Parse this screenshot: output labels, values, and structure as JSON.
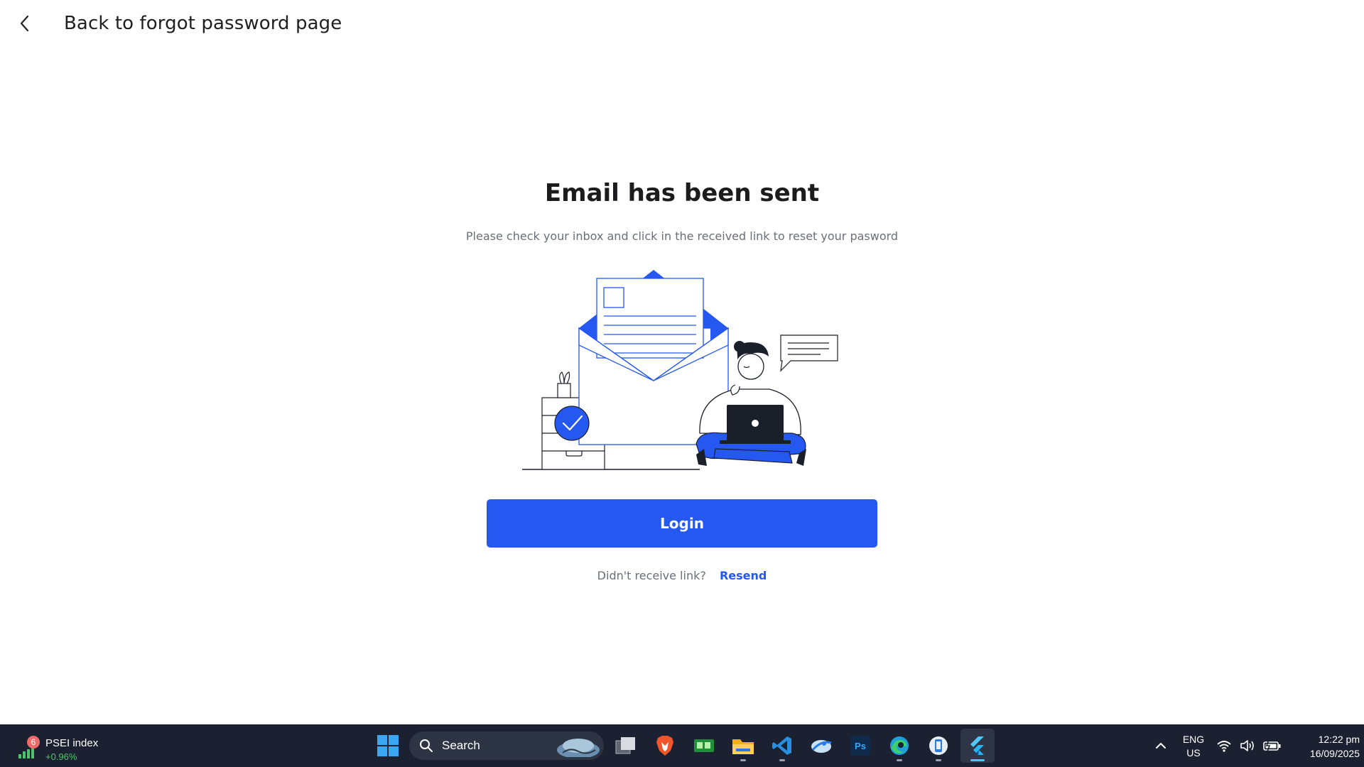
{
  "header": {
    "back_label": "Back to forgot password page"
  },
  "main": {
    "title": "Email has been sent",
    "subtitle": "Please check your inbox and click in the received link to reset your pasword",
    "login_label": "Login",
    "resend_question": "Didn't receive link?",
    "resend_label": "Resend",
    "accent_color": "#2458f0"
  },
  "taskbar": {
    "widget": {
      "badge": "6",
      "title": "PSEI index",
      "change": "+0.96%"
    },
    "search_placeholder": "Search",
    "apps": [
      {
        "name": "task-view-icon"
      },
      {
        "name": "brave-browser-icon"
      },
      {
        "name": "system-monitor-icon"
      },
      {
        "name": "file-explorer-icon"
      },
      {
        "name": "vscode-icon"
      },
      {
        "name": "dbeaver-icon"
      },
      {
        "name": "photoshop-icon",
        "label": "Ps"
      },
      {
        "name": "edge-browser-icon"
      },
      {
        "name": "phone-app-icon"
      },
      {
        "name": "flutter-icon"
      }
    ],
    "language_line1": "ENG",
    "language_line2": "US",
    "time": "12:22 pm",
    "date": "16/09/2025"
  }
}
